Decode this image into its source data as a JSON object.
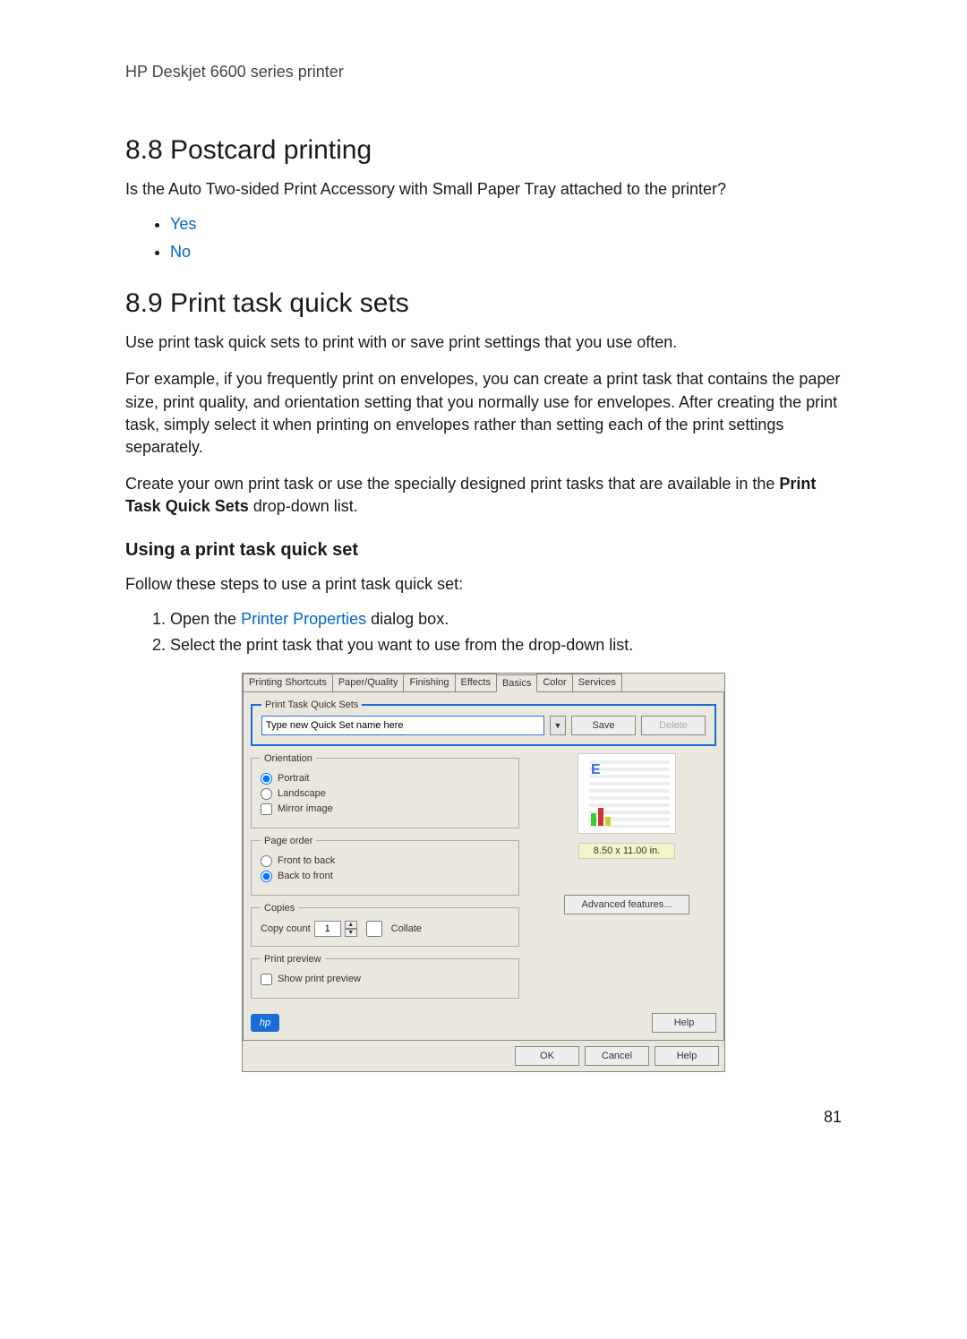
{
  "header": "HP Deskjet 6600 series printer",
  "section88": {
    "title": "8.8  Postcard printing",
    "question": "Is the Auto Two-sided Print Accessory with Small Paper Tray attached to the printer?",
    "yes": "Yes",
    "no": "No"
  },
  "section89": {
    "title": "8.9  Print task quick sets",
    "p1": "Use print task quick sets to print with or save print settings that you use often.",
    "p2": "For example, if you frequently print on envelopes, you can create a print task that contains the paper size, print quality, and orientation setting that you normally use for envelopes. After creating the print task, simply select it when printing on envelopes rather than setting each of the print settings separately.",
    "p3_pre": "Create your own print task or use the specially designed print tasks that are available in the ",
    "p3_bold": "Print Task Quick Sets",
    "p3_post": " drop-down list.",
    "sub": "Using a print task quick set",
    "follow": "Follow these steps to use a print task quick set:",
    "step1_pre": "Open the ",
    "step1_link": "Printer Properties",
    "step1_post": " dialog box.",
    "step2": "Select the print task that you want to use from the drop-down list."
  },
  "dialog": {
    "tabs": [
      "Printing Shortcuts",
      "Paper/Quality",
      "Finishing",
      "Effects",
      "Basics",
      "Color",
      "Services"
    ],
    "active_tab": 4,
    "quicksets_legend": "Print Task Quick Sets",
    "quicksets_placeholder": "Type new Quick Set name here",
    "save": "Save",
    "delete": "Delete",
    "orientation_legend": "Orientation",
    "portrait": "Portrait",
    "landscape": "Landscape",
    "mirror": "Mirror image",
    "pageorder_legend": "Page order",
    "front_to_back": "Front to back",
    "back_to_front": "Back to front",
    "copies_legend": "Copies",
    "copy_count": "Copy count",
    "copy_value": "1",
    "collate": "Collate",
    "preview_legend": "Print preview",
    "show_preview": "Show print preview",
    "dimensions": "8.50 x 11.00 in.",
    "advanced": "Advanced features...",
    "help_btn": "Help",
    "ok": "OK",
    "cancel": "Cancel",
    "help": "Help",
    "hp": "hp"
  },
  "page_number": "81"
}
